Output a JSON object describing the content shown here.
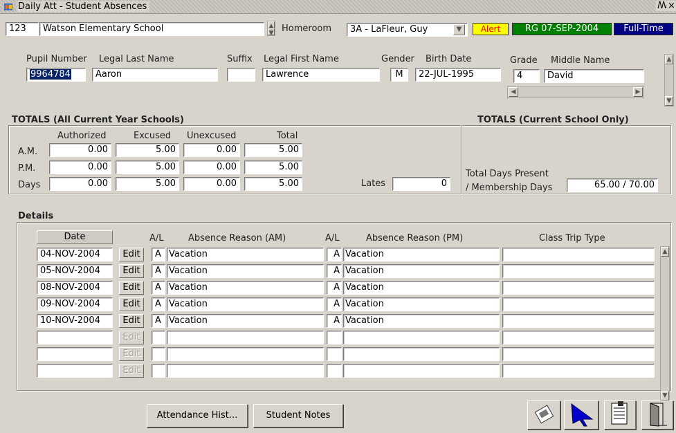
{
  "window": {
    "title": "Daily Att - Student Absences",
    "controls": [
      "ꟿ",
      "×"
    ]
  },
  "header": {
    "school_code": "123",
    "school_name": "Watson Elementary School",
    "homeroom_label": "Homeroom",
    "homeroom_value": "3A - LaFleur, Guy",
    "alert": "Alert",
    "registration": "RG 07-SEP-2004",
    "status": "Full-Time"
  },
  "student": {
    "labels": {
      "pupil_number": "Pupil Number",
      "legal_last_name": "Legal Last Name",
      "suffix": "Suffix",
      "legal_first_name": "Legal First Name",
      "gender": "Gender",
      "birth_date": "Birth Date",
      "grade": "Grade",
      "middle_name": "Middle Name"
    },
    "pupil_number": "9964784",
    "legal_last_name": "Aaron",
    "suffix": "",
    "legal_first_name": "Lawrence",
    "gender": "M",
    "birth_date": "22-JUL-1995",
    "grade": "4",
    "middle_name": "David"
  },
  "totals_all": {
    "title": "TOTALS (All Current Year Schools)",
    "columns": [
      "Authorized",
      "Excused",
      "Unexcused",
      "Total"
    ],
    "rows": [
      {
        "label": "A.M.",
        "values": [
          "0.00",
          "5.00",
          "0.00",
          "5.00"
        ]
      },
      {
        "label": "P.M.",
        "values": [
          "0.00",
          "5.00",
          "0.00",
          "5.00"
        ]
      },
      {
        "label": "Days",
        "values": [
          "0.00",
          "5.00",
          "0.00",
          "5.00"
        ]
      }
    ],
    "lates_label": "Lates",
    "lates_value": "0"
  },
  "totals_current": {
    "title": "TOTALS (Current School Only)",
    "present_label_1": "Total Days Present",
    "present_label_2": "/ Membership Days",
    "present_value": "65.00 / 70.00"
  },
  "details": {
    "title": "Details",
    "columns": {
      "date": "Date",
      "al_am": "A/L",
      "reason_am": "Absence Reason (AM)",
      "al_pm": "A/L",
      "reason_pm": "Absence Reason (PM)",
      "trip": "Class Trip Type"
    },
    "edit_label": "Edit",
    "rows": [
      {
        "date": "04-NOV-2004",
        "al_am": "A",
        "reason_am": "Vacation",
        "al_pm": "A",
        "reason_pm": "Vacation",
        "trip": ""
      },
      {
        "date": "05-NOV-2004",
        "al_am": "A",
        "reason_am": "Vacation",
        "al_pm": "A",
        "reason_pm": "Vacation",
        "trip": ""
      },
      {
        "date": "08-NOV-2004",
        "al_am": "A",
        "reason_am": "Vacation",
        "al_pm": "A",
        "reason_pm": "Vacation",
        "trip": ""
      },
      {
        "date": "09-NOV-2004",
        "al_am": "A",
        "reason_am": "Vacation",
        "al_pm": "A",
        "reason_pm": "Vacation",
        "trip": ""
      },
      {
        "date": "10-NOV-2004",
        "al_am": "A",
        "reason_am": "Vacation",
        "al_pm": "A",
        "reason_pm": "Vacation",
        "trip": ""
      },
      {
        "date": "",
        "al_am": "",
        "reason_am": "",
        "al_pm": "",
        "reason_pm": "",
        "trip": ""
      },
      {
        "date": "",
        "al_am": "",
        "reason_am": "",
        "al_pm": "",
        "reason_pm": "",
        "trip": ""
      },
      {
        "date": "",
        "al_am": "",
        "reason_am": "",
        "al_pm": "",
        "reason_pm": "",
        "trip": ""
      }
    ]
  },
  "footer": {
    "attendance_history": "Attendance Hist...",
    "student_notes": "Student Notes",
    "icons": [
      "print-icon",
      "cursor-icon",
      "save-icon",
      "exit-icon"
    ]
  },
  "colors": {
    "alert_bg": "#ffff00",
    "alert_fg": "#ff0000",
    "registration_bg": "#008000",
    "status_bg": "#000080",
    "selection_bg": "#0a246a"
  }
}
